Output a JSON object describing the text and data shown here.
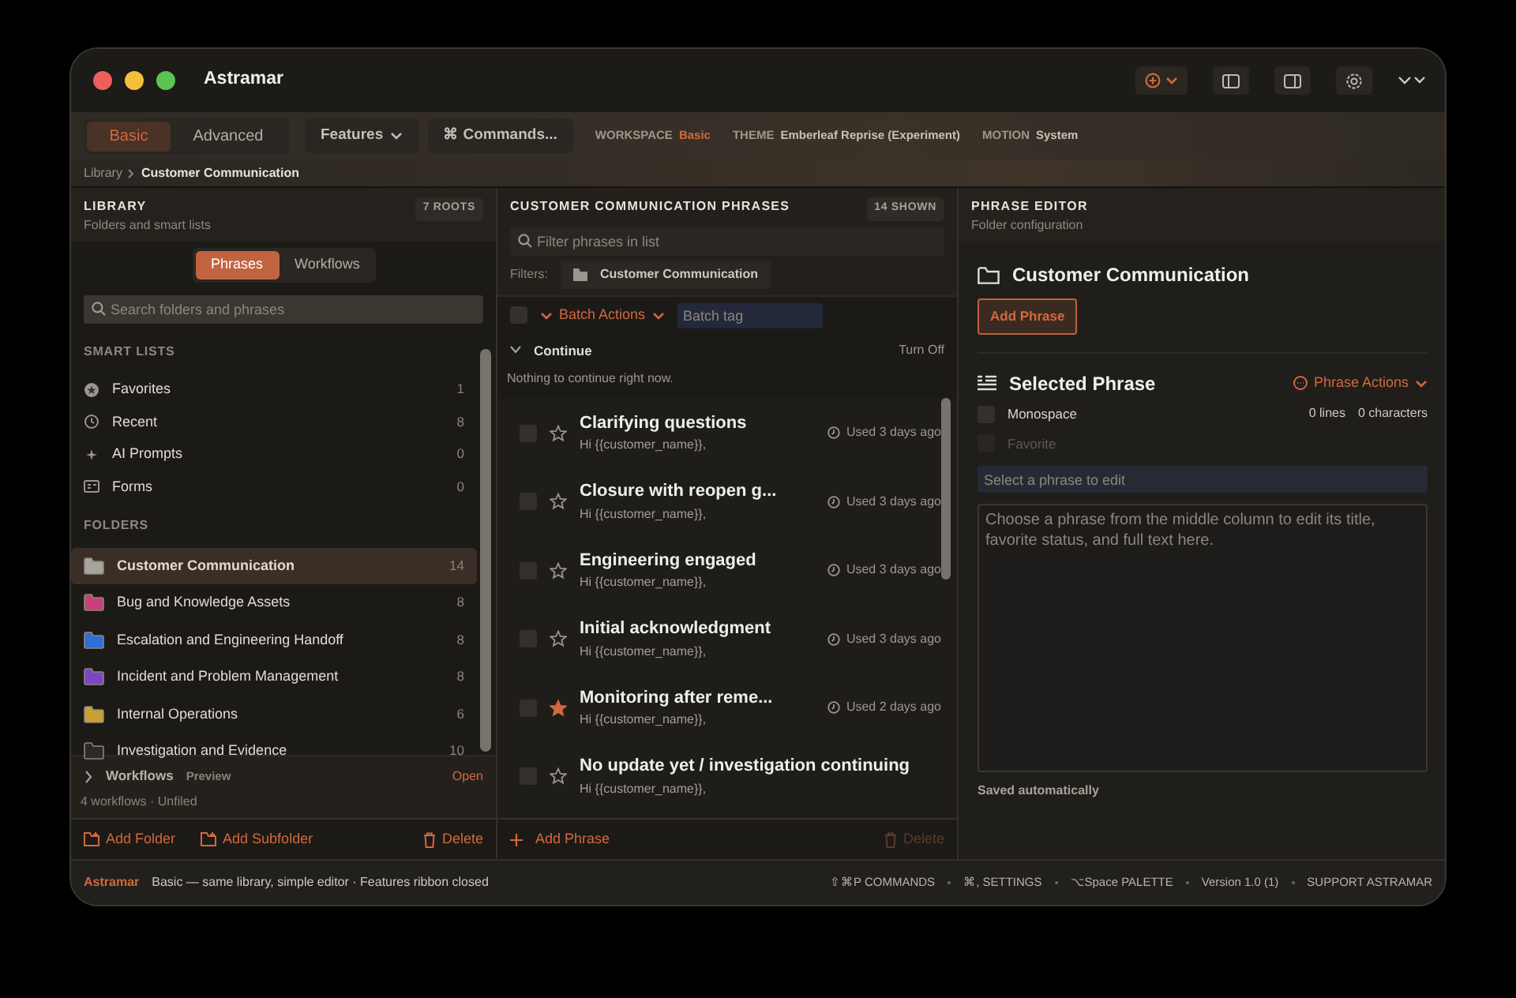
{
  "window": {
    "title": "Astramar"
  },
  "toolbar": {
    "modes": [
      {
        "label": "Basic",
        "selected": true
      },
      {
        "label": "Advanced",
        "selected": false
      }
    ],
    "features": "Features",
    "commands": "⌘ Commands...",
    "info": [
      {
        "key": "WORKSPACE",
        "value": "Basic",
        "accent": true
      },
      {
        "key": "THEME",
        "value": "Emberleaf Reprise (Experiment)",
        "accent": false
      },
      {
        "key": "MOTION",
        "value": "System",
        "accent": false
      }
    ]
  },
  "breadcrumb": [
    "Library",
    "Customer Communication"
  ],
  "library": {
    "title": "LIBRARY",
    "subtitle": "Folders and smart lists",
    "badge": "7 ROOTS",
    "tabs": [
      {
        "label": "Phrases",
        "selected": true
      },
      {
        "label": "Workflows",
        "selected": false
      }
    ],
    "search": {
      "placeholder": "Search folders and phrases"
    },
    "smart_title": "SMART LISTS",
    "smart_lists": [
      {
        "kind": "favorites",
        "label": "Favorites",
        "count": "1"
      },
      {
        "kind": "recent",
        "label": "Recent",
        "count": "8"
      },
      {
        "kind": "ai",
        "label": "AI Prompts",
        "count": "0"
      },
      {
        "kind": "forms",
        "label": "Forms",
        "count": "0"
      }
    ],
    "folders_title": "FOLDERS",
    "folders": [
      {
        "label": "Customer Communication",
        "count": "14",
        "color": "#a8a49c",
        "selected": true
      },
      {
        "label": "Bug and Knowledge Assets",
        "count": "8",
        "color": "#c8407a",
        "selected": false
      },
      {
        "label": "Escalation and Engineering Handoff",
        "count": "8",
        "color": "#2f6fd6",
        "selected": false
      },
      {
        "label": "Incident and Problem Management",
        "count": "8",
        "color": "#7b45c8",
        "selected": false
      },
      {
        "label": "Internal Operations",
        "count": "6",
        "color": "#caa032",
        "selected": false
      },
      {
        "label": "Investigation and Evidence",
        "count": "10",
        "color": "#2c2a27",
        "selected": false
      }
    ],
    "workflows": {
      "title": "Workflows",
      "tag": "Preview",
      "action": "Open",
      "expanded": false,
      "summary": "4 workflows · Unfiled"
    },
    "footer": [
      "Add Folder",
      "Add Subfolder",
      "Delete"
    ]
  },
  "phrases": {
    "title": "CUSTOMER COMMUNICATION PHRASES",
    "badge": "14 SHOWN",
    "filter": {
      "placeholder": "Filter phrases in list"
    },
    "filters_label": "Filters:",
    "filter_chip": "Customer Communication",
    "select_all": {
      "checked": false
    },
    "batch_actions": "Batch Actions",
    "batch_tag": {
      "placeholder": "Batch tag"
    },
    "continue": {
      "title": "Continue",
      "expanded": true,
      "action": "Turn Off",
      "empty": "Nothing to continue right now."
    },
    "items": [
      {
        "title": "Clarifying questions",
        "preview": "Hi {{customer_name}},",
        "used": "Used 3 days ago",
        "favorite": false,
        "checked": false
      },
      {
        "title": "Closure with reopen g...",
        "preview": "Hi {{customer_name}},",
        "used": "Used 3 days ago",
        "favorite": false,
        "checked": false
      },
      {
        "title": "Engineering engaged",
        "preview": "Hi {{customer_name}},",
        "used": "Used 3 days ago",
        "favorite": false,
        "checked": false
      },
      {
        "title": "Initial acknowledgment",
        "preview": "Hi {{customer_name}},",
        "used": "Used 3 days ago",
        "favorite": false,
        "checked": false
      },
      {
        "title": "Monitoring after reme...",
        "preview": "Hi {{customer_name}},",
        "used": "Used 2 days ago",
        "favorite": true,
        "checked": false
      },
      {
        "title": "No update yet / investigation continuing",
        "preview": "Hi {{customer_name}},",
        "favorite": false,
        "checked": false
      }
    ],
    "footer": {
      "add": "Add Phrase",
      "delete": "Delete",
      "delete_disabled": true
    }
  },
  "editor": {
    "title": "PHRASE EDITOR",
    "subtitle": "Folder configuration",
    "folder": "Customer Communication",
    "add_button": "Add Phrase",
    "selected_title": "Selected Phrase",
    "actions": "Phrase Actions",
    "options": [
      {
        "label": "Monospace",
        "checked": false,
        "disabled": false
      },
      {
        "label": "Favorite",
        "checked": false,
        "disabled": true
      }
    ],
    "lines": "0 lines",
    "characters": "0 characters",
    "title_field": {
      "placeholder": "Select a phrase to edit"
    },
    "body_field": {
      "placeholder": "Choose a phrase from the middle column to edit its title, favorite status, and full text here."
    },
    "status": "Saved automatically"
  },
  "status_bar": {
    "app": "Astramar",
    "message": "Basic — same library, simple editor · Features ribbon closed",
    "items": [
      "⇧⌘P COMMANDS",
      "⌘, SETTINGS",
      "⌥Space PALETTE",
      "Version 1.0 (1)",
      "SUPPORT ASTRAMAR"
    ]
  }
}
